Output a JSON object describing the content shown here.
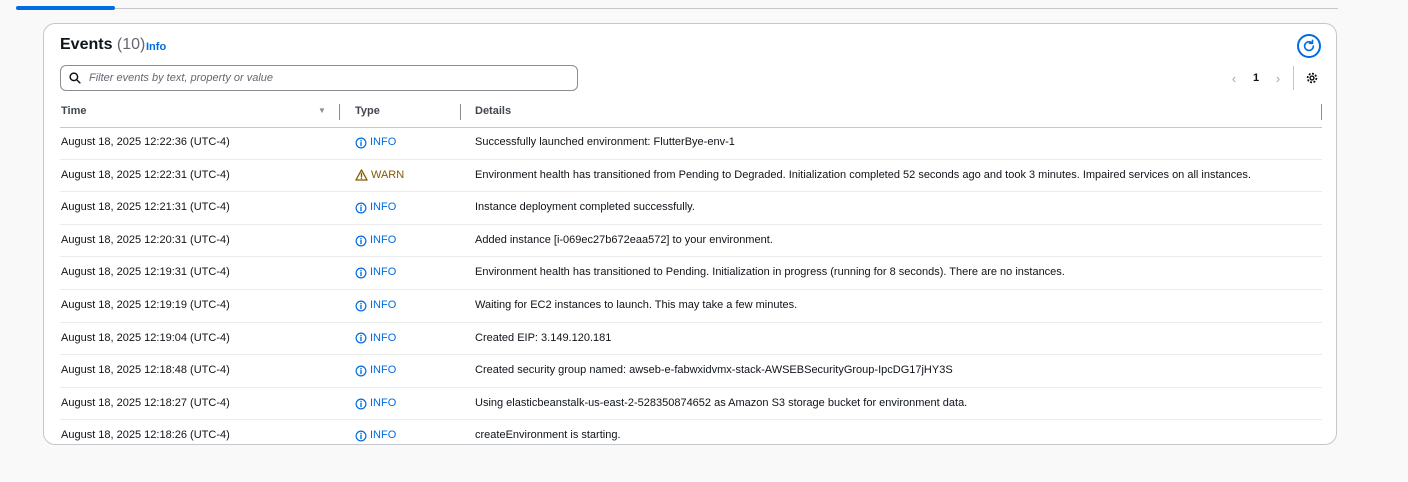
{
  "events": {
    "title": "Events",
    "count": "(10)",
    "info_link": "Info",
    "filter_placeholder": "Filter events by text, property or value",
    "pagination": {
      "current_page": "1"
    },
    "columns": {
      "time": "Time",
      "type": "Type",
      "details": "Details"
    },
    "rows": [
      {
        "time": "August 18, 2025 12:22:36 (UTC-4)",
        "type": "INFO",
        "details": "Successfully launched environment: FlutterBye-env-1"
      },
      {
        "time": "August 18, 2025 12:22:31 (UTC-4)",
        "type": "WARN",
        "details": "Environment health has transitioned from Pending to Degraded. Initialization completed 52 seconds ago and took 3 minutes. Impaired services on all instances."
      },
      {
        "time": "August 18, 2025 12:21:31 (UTC-4)",
        "type": "INFO",
        "details": "Instance deployment completed successfully."
      },
      {
        "time": "August 18, 2025 12:20:31 (UTC-4)",
        "type": "INFO",
        "details": "Added instance [i-069ec27b672eaa572] to your environment."
      },
      {
        "time": "August 18, 2025 12:19:31 (UTC-4)",
        "type": "INFO",
        "details": "Environment health has transitioned to Pending. Initialization in progress (running for 8 seconds). There are no instances."
      },
      {
        "time": "August 18, 2025 12:19:19 (UTC-4)",
        "type": "INFO",
        "details": "Waiting for EC2 instances to launch. This may take a few minutes."
      },
      {
        "time": "August 18, 2025 12:19:04 (UTC-4)",
        "type": "INFO",
        "details": "Created EIP: 3.149.120.181"
      },
      {
        "time": "August 18, 2025 12:18:48 (UTC-4)",
        "type": "INFO",
        "details": "Created security group named: awseb-e-fabwxidvmx-stack-AWSEBSecurityGroup-IpcDG17jHY3S"
      },
      {
        "time": "August 18, 2025 12:18:27 (UTC-4)",
        "type": "INFO",
        "details": "Using elasticbeanstalk-us-east-2-528350874652 as Amazon S3 storage bucket for environment data."
      },
      {
        "time": "August 18, 2025 12:18:26 (UTC-4)",
        "type": "INFO",
        "details": "createEnvironment is starting."
      }
    ]
  },
  "icons": {
    "refresh": "refresh-icon",
    "search": "search-icon",
    "settings": "gear-icon",
    "info": "info-circle-icon",
    "warn": "warning-triangle-icon",
    "sort": "caret-down-icon"
  },
  "colors": {
    "accent": "#006ce0",
    "info": "#006ce0",
    "warn": "#855900",
    "border": "#c6c6cd"
  }
}
